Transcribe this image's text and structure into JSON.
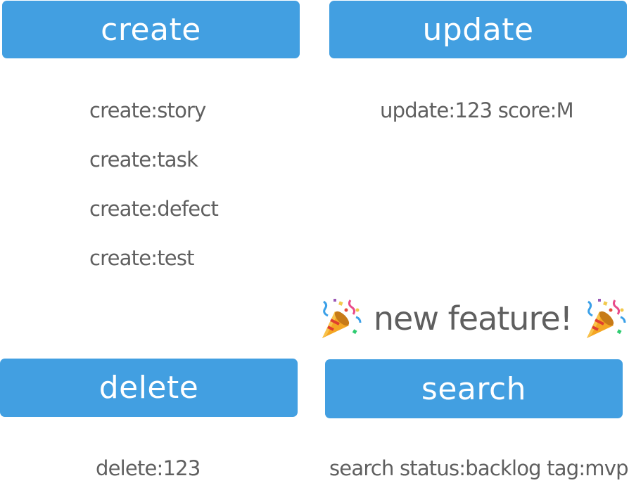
{
  "buttons": {
    "create": "create",
    "update": "update",
    "delete": "delete",
    "search": "search"
  },
  "create_examples": [
    "create:story",
    "create:task",
    "create:defect",
    "create:test"
  ],
  "update_examples": [
    "update:123 score:M"
  ],
  "delete_examples": [
    "delete:123"
  ],
  "search_examples": [
    "search status:backlog tag:mvp"
  ],
  "banner": {
    "text": "new feature!",
    "icon_left": "party-popper-icon",
    "icon_right": "party-popper-icon"
  },
  "colors": {
    "button_bg": "#429fe1",
    "button_text": "#ffffff",
    "example_text": "#5f5f5f"
  }
}
